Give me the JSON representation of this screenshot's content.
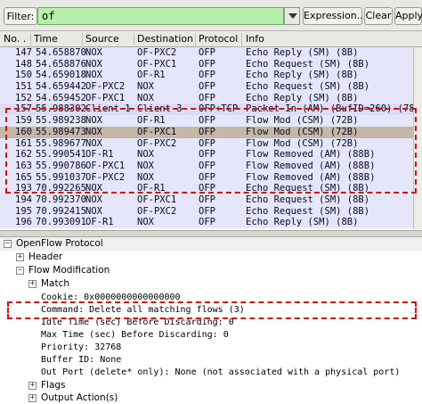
{
  "toolbar": {
    "filter_label": "Filter:",
    "filter_value": "of",
    "expression_label": "Expression...",
    "clear_label": "Clear",
    "apply_label": "Apply"
  },
  "columns": [
    "No. .",
    "Time",
    "Source",
    "Destination",
    "Protocol",
    "Info"
  ],
  "packets": [
    {
      "no": "147",
      "time": "54.658870",
      "src": "NOX",
      "dst": "OF-PXC2",
      "proto": "OFP",
      "info": "Echo Reply (SM) (8B)",
      "style": "echo"
    },
    {
      "no": "148",
      "time": "54.658876",
      "src": "NOX",
      "dst": "OF-PXC1",
      "proto": "OFP",
      "info": "Echo Request (SM) (8B)",
      "style": "echo"
    },
    {
      "no": "150",
      "time": "54.659018",
      "src": "NOX",
      "dst": "OF-R1",
      "proto": "OFP",
      "info": "Echo Reply (SM) (8B)",
      "style": "echo"
    },
    {
      "no": "151",
      "time": "54.659442",
      "src": "OF-PXC2",
      "dst": "NOX",
      "proto": "OFP",
      "info": "Echo Request (SM) (8B)",
      "style": "echo"
    },
    {
      "no": "152",
      "time": "54.659452",
      "src": "OF-PXC1",
      "dst": "NOX",
      "proto": "OFP",
      "info": "Echo Reply (SM) (8B)",
      "style": "echo"
    },
    {
      "no": "157",
      "time": "55.988302",
      "src": "Client-1",
      "dst": "Client-3",
      "proto": "OFP+TCP",
      "info": "Packet In (AM) (BufID=260) (78B)",
      "style": "packetin"
    },
    {
      "no": "159",
      "time": "55.989238",
      "src": "NOX",
      "dst": "OF-R1",
      "proto": "OFP",
      "info": "Flow Mod (CSM) (72B)",
      "style": "flow"
    },
    {
      "no": "160",
      "time": "55.989473",
      "src": "NOX",
      "dst": "OF-PXC1",
      "proto": "OFP",
      "info": "Flow Mod (CSM) (72B)",
      "style": "selected"
    },
    {
      "no": "161",
      "time": "55.989677",
      "src": "NOX",
      "dst": "OF-PXC2",
      "proto": "OFP",
      "info": "Flow Mod (CSM) (72B)",
      "style": "flow"
    },
    {
      "no": "162",
      "time": "55.990541",
      "src": "OF-R1",
      "dst": "NOX",
      "proto": "OFP",
      "info": "Flow Removed (AM) (88B)",
      "style": "flow"
    },
    {
      "no": "163",
      "time": "55.990786",
      "src": "OF-PXC1",
      "dst": "NOX",
      "proto": "OFP",
      "info": "Flow Removed (AM) (88B)",
      "style": "flow"
    },
    {
      "no": "165",
      "time": "55.991037",
      "src": "OF-PXC2",
      "dst": "NOX",
      "proto": "OFP",
      "info": "Flow Removed (AM) (88B)",
      "style": "flow"
    },
    {
      "no": "193",
      "time": "70.992265",
      "src": "NOX",
      "dst": "OF-R1",
      "proto": "OFP",
      "info": "Echo Request (SM) (8B)",
      "style": "echo"
    },
    {
      "no": "194",
      "time": "70.992370",
      "src": "NOX",
      "dst": "OF-PXC1",
      "proto": "OFP",
      "info": "Echo Request (SM) (8B)",
      "style": "echo"
    },
    {
      "no": "195",
      "time": "70.992415",
      "src": "NOX",
      "dst": "OF-PXC2",
      "proto": "OFP",
      "info": "Echo Request (SM) (8B)",
      "style": "echo"
    },
    {
      "no": "196",
      "time": "70.993091",
      "src": "OF-R1",
      "dst": "NOX",
      "proto": "OFP",
      "info": "Echo Reply (SM) (8B)",
      "style": "echo"
    }
  ],
  "details": {
    "protocol": "OpenFlow Protocol",
    "header": "Header",
    "flow_mod": "Flow Modification",
    "match": "Match",
    "cookie": "Cookie: 0x0000000000000000",
    "command": "Command: Delete all matching flows (3)",
    "idle_time": "Idle Time (sec) Before Discarding: 0",
    "max_time": "Max Time (sec) Before Discarding: 0",
    "priority": "Priority: 32768",
    "buffer_id": "Buffer ID: None",
    "out_port": "Out Port (delete* only): None  (not associated with a physical port)",
    "flags": "Flags",
    "output_action": "Output Action(s)"
  }
}
